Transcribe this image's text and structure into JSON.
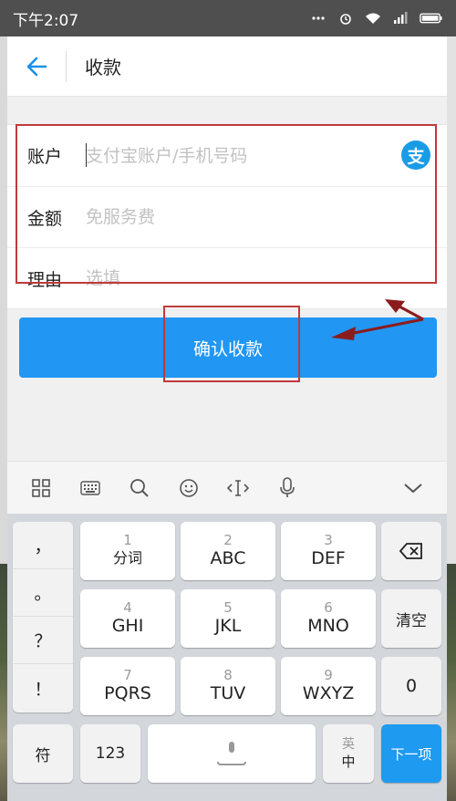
{
  "status_bar": {
    "time": "下午2:07"
  },
  "header": {
    "title": "收款"
  },
  "form": {
    "account": {
      "label": "账户",
      "placeholder": "支付宝账户/手机号码"
    },
    "amount": {
      "label": "金额",
      "placeholder": "免服务费"
    },
    "reason": {
      "label": "理由",
      "placeholder": "选填"
    },
    "alipay_badge": "支"
  },
  "confirm_button": {
    "label": "确认收款"
  },
  "keyboard": {
    "punctuation": [
      "，",
      "。",
      "？",
      "！"
    ],
    "rows": [
      [
        {
          "num": "1",
          "label": "分词"
        },
        {
          "num": "2",
          "label": "ABC"
        },
        {
          "num": "3",
          "label": "DEF"
        }
      ],
      [
        {
          "num": "4",
          "label": "GHI"
        },
        {
          "num": "5",
          "label": "JKL"
        },
        {
          "num": "6",
          "label": "MNO"
        }
      ],
      [
        {
          "num": "7",
          "label": "PQRS"
        },
        {
          "num": "8",
          "label": "TUV"
        },
        {
          "num": "9",
          "label": "WXYZ"
        }
      ]
    ],
    "clear": "清空",
    "zero": "0",
    "symbol": "符",
    "num_switch": "123",
    "lang_top": "英",
    "lang_bottom": "中",
    "next": "下一项"
  },
  "colors": {
    "accent": "#2196f3",
    "highlight": "#c0393b"
  }
}
